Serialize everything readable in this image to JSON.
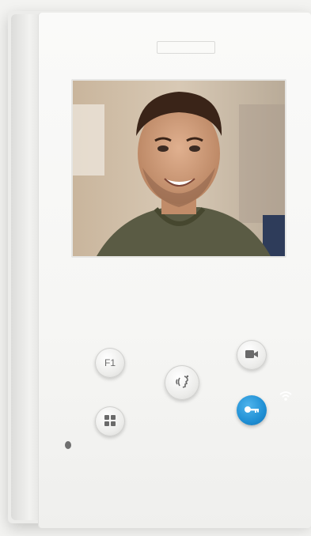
{
  "device": {
    "brand_text": "",
    "buttons": {
      "f1_label": "F1"
    },
    "colors": {
      "body": "#f6f6f4",
      "key_button": "#1f8fd4",
      "icon_gray": "#6a6a6a"
    },
    "icons": {
      "camera": "camera-icon",
      "talk": "talk-icon",
      "key": "key-icon",
      "menu": "grid-icon",
      "wifi": "wifi-icon"
    }
  }
}
